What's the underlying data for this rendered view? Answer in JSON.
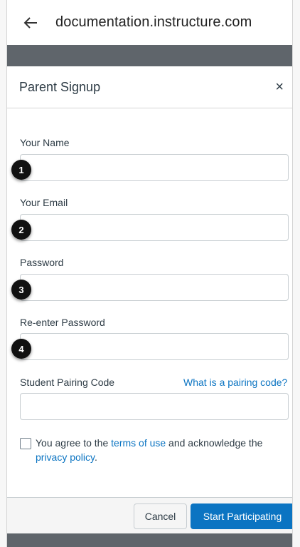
{
  "browser": {
    "url": "documentation.instructure.com"
  },
  "modal": {
    "title": "Parent Signup",
    "close_symbol": "×"
  },
  "form": {
    "name_label": "Your Name",
    "email_label": "Your Email",
    "password_label": "Password",
    "reenter_label": "Re-enter Password",
    "pairing_label": "Student Pairing Code",
    "pairing_link": "What is a pairing code?",
    "name_value": "",
    "email_value": "",
    "password_value": "",
    "reenter_value": "",
    "pairing_value": ""
  },
  "agreement": {
    "prefix": "You agree to the ",
    "terms_link": "terms of use",
    "middle": " and acknowledge the ",
    "privacy_link": "privacy policy",
    "suffix": "."
  },
  "buttons": {
    "cancel": "Cancel",
    "start": "Start Participating"
  },
  "badges": [
    "1",
    "2",
    "3",
    "4"
  ],
  "colors": {
    "accent": "#0b74c2",
    "dark_bar": "#5f656b"
  },
  "icons": {
    "back": "arrow-left-icon",
    "close": "close-icon"
  }
}
